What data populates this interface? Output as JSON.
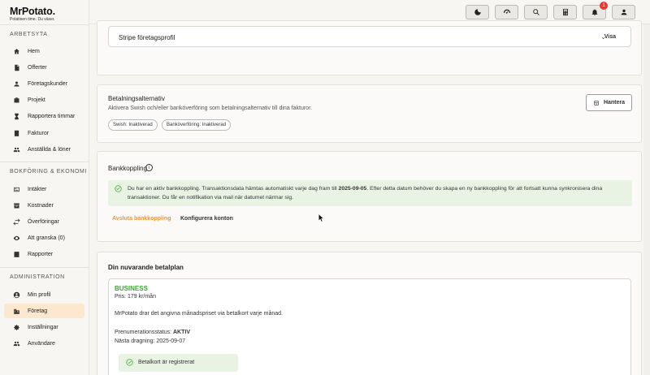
{
  "app": {
    "logo_name": "MrPotato.",
    "logo_tagline": "Potatisen time. Du växer."
  },
  "sidebar": {
    "sections": [
      {
        "title": "ARBETSYTA",
        "items": [
          {
            "label": "Hem",
            "icon": "home-icon"
          },
          {
            "label": "Offerter",
            "icon": "document-icon"
          },
          {
            "label": "Företagskunder",
            "icon": "person-icon"
          },
          {
            "label": "Projekt",
            "icon": "briefcase-icon"
          },
          {
            "label": "Rapportera timmar",
            "icon": "hourglass-icon"
          },
          {
            "label": "Fakturor",
            "icon": "invoice-icon"
          },
          {
            "label": "Anställda & löner",
            "icon": "people-icon"
          }
        ]
      },
      {
        "title": "BOKFÖRING & EKONOMI",
        "items": [
          {
            "label": "Intäkter",
            "icon": "income-icon"
          },
          {
            "label": "Kostnader",
            "icon": "cost-icon"
          },
          {
            "label": "Överföringar",
            "icon": "transfer-icon"
          },
          {
            "label": "Att granska (0)",
            "icon": "eye-icon"
          },
          {
            "label": "Rapporter",
            "icon": "report-icon"
          }
        ]
      },
      {
        "title": "ADMINISTRATION",
        "items": [
          {
            "label": "Min profil",
            "icon": "profile-icon"
          },
          {
            "label": "Företag",
            "icon": "company-icon",
            "active": true
          },
          {
            "label": "Inställningar",
            "icon": "gear-icon"
          },
          {
            "label": "Användare",
            "icon": "users-icon"
          }
        ]
      }
    ]
  },
  "topbar": {
    "notification_count": "1",
    "buttons": [
      "moon-icon",
      "speed-icon",
      "search-icon",
      "calculator-icon",
      "bell-icon",
      "account-icon"
    ]
  },
  "stripe": {
    "label": "Stripe företagsprofil",
    "toggle_label": "Visa"
  },
  "payment": {
    "title": "Betalningsalternativ",
    "description": "Aktivera Swish och/eller banköverföring som betalningsalternativ till dina fakturor.",
    "chips": [
      "Swish: Inaktiverad",
      "Banköverföring: Inaktiverad"
    ],
    "manage_label": "Hantera"
  },
  "bank": {
    "title": "Bankkoppling",
    "alert_line1_pre": "Du har en aktiv bankkoppling. Transaktionsdata hämtas automatiskt varje dag fram till ",
    "alert_date": "2025-09-05",
    "alert_line1_post": ". Efter detta datum behöver du skapa en ny bankkoppling för att fortsatt kunna synkronisera dina",
    "alert_line2": "transaktioner. Du får en notifikation via mail när datumet närmar sig.",
    "end_label": "Avsluta bankkoppling",
    "configure_label": "Konfigurera konton"
  },
  "plan": {
    "section_title": "Din nuvarande betalplan",
    "name": "BUSINESS",
    "price": "Pris: 179 kr/mån",
    "description": "MrPotato drar det angivna månadspriset via betalkort varje månad.",
    "status_label": "Prenumerationsstatus:",
    "status_value": "AKTIV",
    "next_charge": "Nästa dragning: 2025-09-07",
    "card_registered": "Betalkort är registrerat"
  },
  "colors": {
    "accent": "#e8963c",
    "plan_green": "#3aa82e",
    "alert_bg": "#e8f3e4",
    "active_bg": "#fbe8cf"
  }
}
